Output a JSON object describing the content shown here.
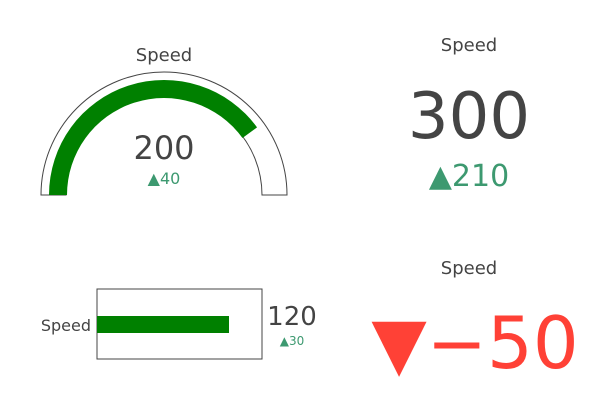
{
  "colors": {
    "bar": "#008000",
    "text": "#444444",
    "increase": "#3d9970",
    "decrease": "#ff4136",
    "outline": "#444444"
  },
  "chart_data": [
    {
      "type": "gauge",
      "shape": "angular",
      "title": "Speed",
      "value": 200,
      "delta": 40,
      "delta_text": "▲40",
      "range": [
        0,
        250
      ]
    },
    {
      "type": "number-delta",
      "title": "Speed",
      "value": 300,
      "delta": 210,
      "delta_text": "▲210"
    },
    {
      "type": "gauge",
      "shape": "bullet",
      "title": "Speed",
      "value": 120,
      "delta": 30,
      "delta_text": "▲30",
      "range": [
        0,
        150
      ]
    },
    {
      "type": "delta",
      "title": "Speed",
      "delta": -50,
      "delta_text": "▼−50"
    }
  ]
}
